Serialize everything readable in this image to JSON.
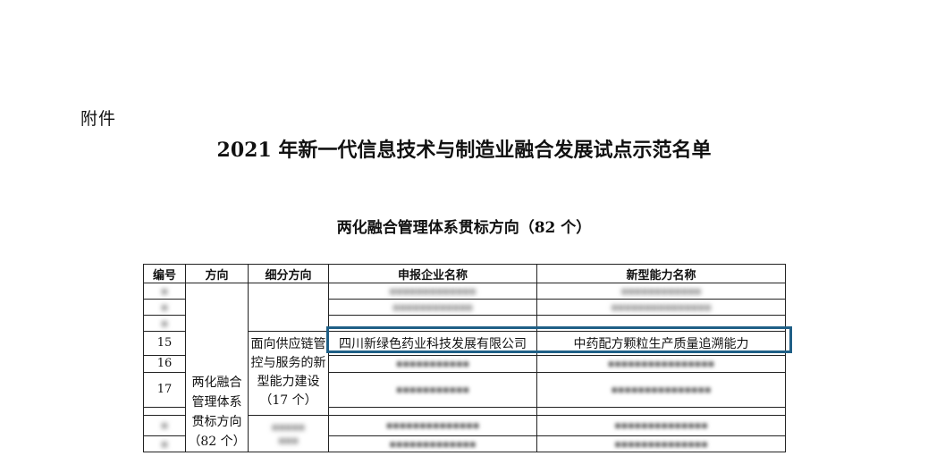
{
  "document": {
    "attachment_label": "附件",
    "title": "2021 年新一代信息技术与制造业融合发展试点示范名单",
    "subtitle": "两化融合管理体系贯标方向（82 个）"
  },
  "table": {
    "headers": [
      "编号",
      "方向",
      "细分方向",
      "申报企业名称",
      "新型能力名称"
    ],
    "direction": "两化融合管理体系贯标方向（82 个）",
    "direction_lines": [
      "两化融合",
      "管理体系",
      "贯标方向",
      "（82 个）"
    ],
    "sub_direction_lines": [
      "面向供应链管",
      "控与服务的新",
      "型能力建设",
      "（17 个）"
    ],
    "highlighted_row": {
      "no": "15",
      "company": "四川新绿色药业科技发展有限公司",
      "capability": "中药配方颗粒生产质量追溯能力"
    },
    "visible_numbers": [
      "16",
      "17"
    ]
  },
  "colors": {
    "highlight_border": "#1f5f86"
  }
}
